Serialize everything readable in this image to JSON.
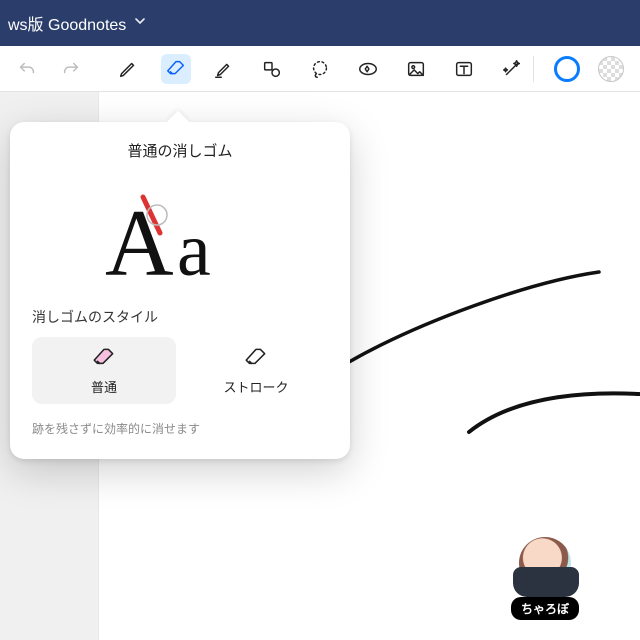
{
  "titlebar": {
    "label": "ws版 Goodnotes"
  },
  "toolbar": {
    "color_ring": "#0a7cff"
  },
  "popover": {
    "title": "普通の消しゴム",
    "section_label": "消しゴムのスタイル",
    "options": {
      "normal": "普通",
      "stroke": "ストローク"
    },
    "hint": "跡を残さずに効率的に消せます"
  },
  "avatar": {
    "name": "ちゃろぼ"
  }
}
